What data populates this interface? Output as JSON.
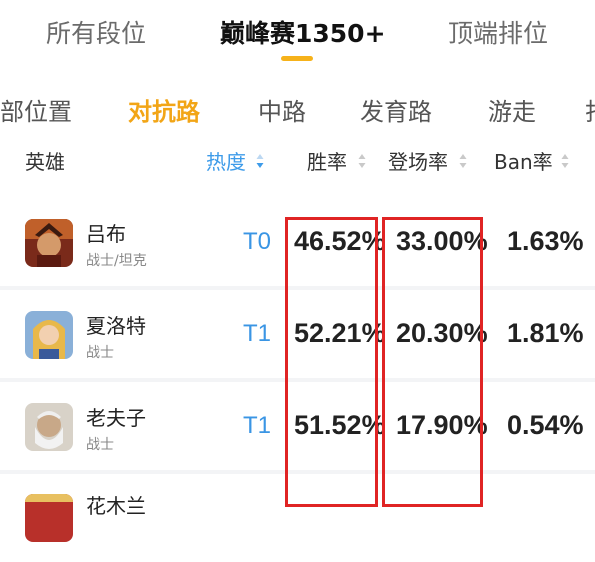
{
  "top_tabs": [
    {
      "label": "所有段位"
    },
    {
      "label": "巅峰赛1350+"
    },
    {
      "label": "顶端排位"
    }
  ],
  "role_tabs": [
    {
      "label": "部位置"
    },
    {
      "label": "对抗路"
    },
    {
      "label": "中路"
    },
    {
      "label": "发育路"
    },
    {
      "label": "游走"
    },
    {
      "label": "打"
    }
  ],
  "table": {
    "headers": {
      "hero": "英雄",
      "heat": "热度",
      "win_rate": "胜率",
      "pick_rate": "登场率",
      "ban_rate": "Ban率"
    },
    "rows": [
      {
        "name": "吕布",
        "role": "战士/坦克",
        "tier": "T0",
        "win": "46.52%",
        "pick": "33.00%",
        "ban": "1.63%"
      },
      {
        "name": "夏洛特",
        "role": "战士",
        "tier": "T1",
        "win": "52.21%",
        "pick": "20.30%",
        "ban": "1.81%"
      },
      {
        "name": "老夫子",
        "role": "战士",
        "tier": "T1",
        "win": "51.52%",
        "pick": "17.90%",
        "ban": "0.54%"
      },
      {
        "name": "花木兰",
        "role": "",
        "tier": "",
        "win": "",
        "pick": "",
        "ban": ""
      }
    ]
  },
  "colors": {
    "accent_orange": "#f2a516",
    "tier_blue": "#3a95e4",
    "highlight_red": "#e02424"
  }
}
